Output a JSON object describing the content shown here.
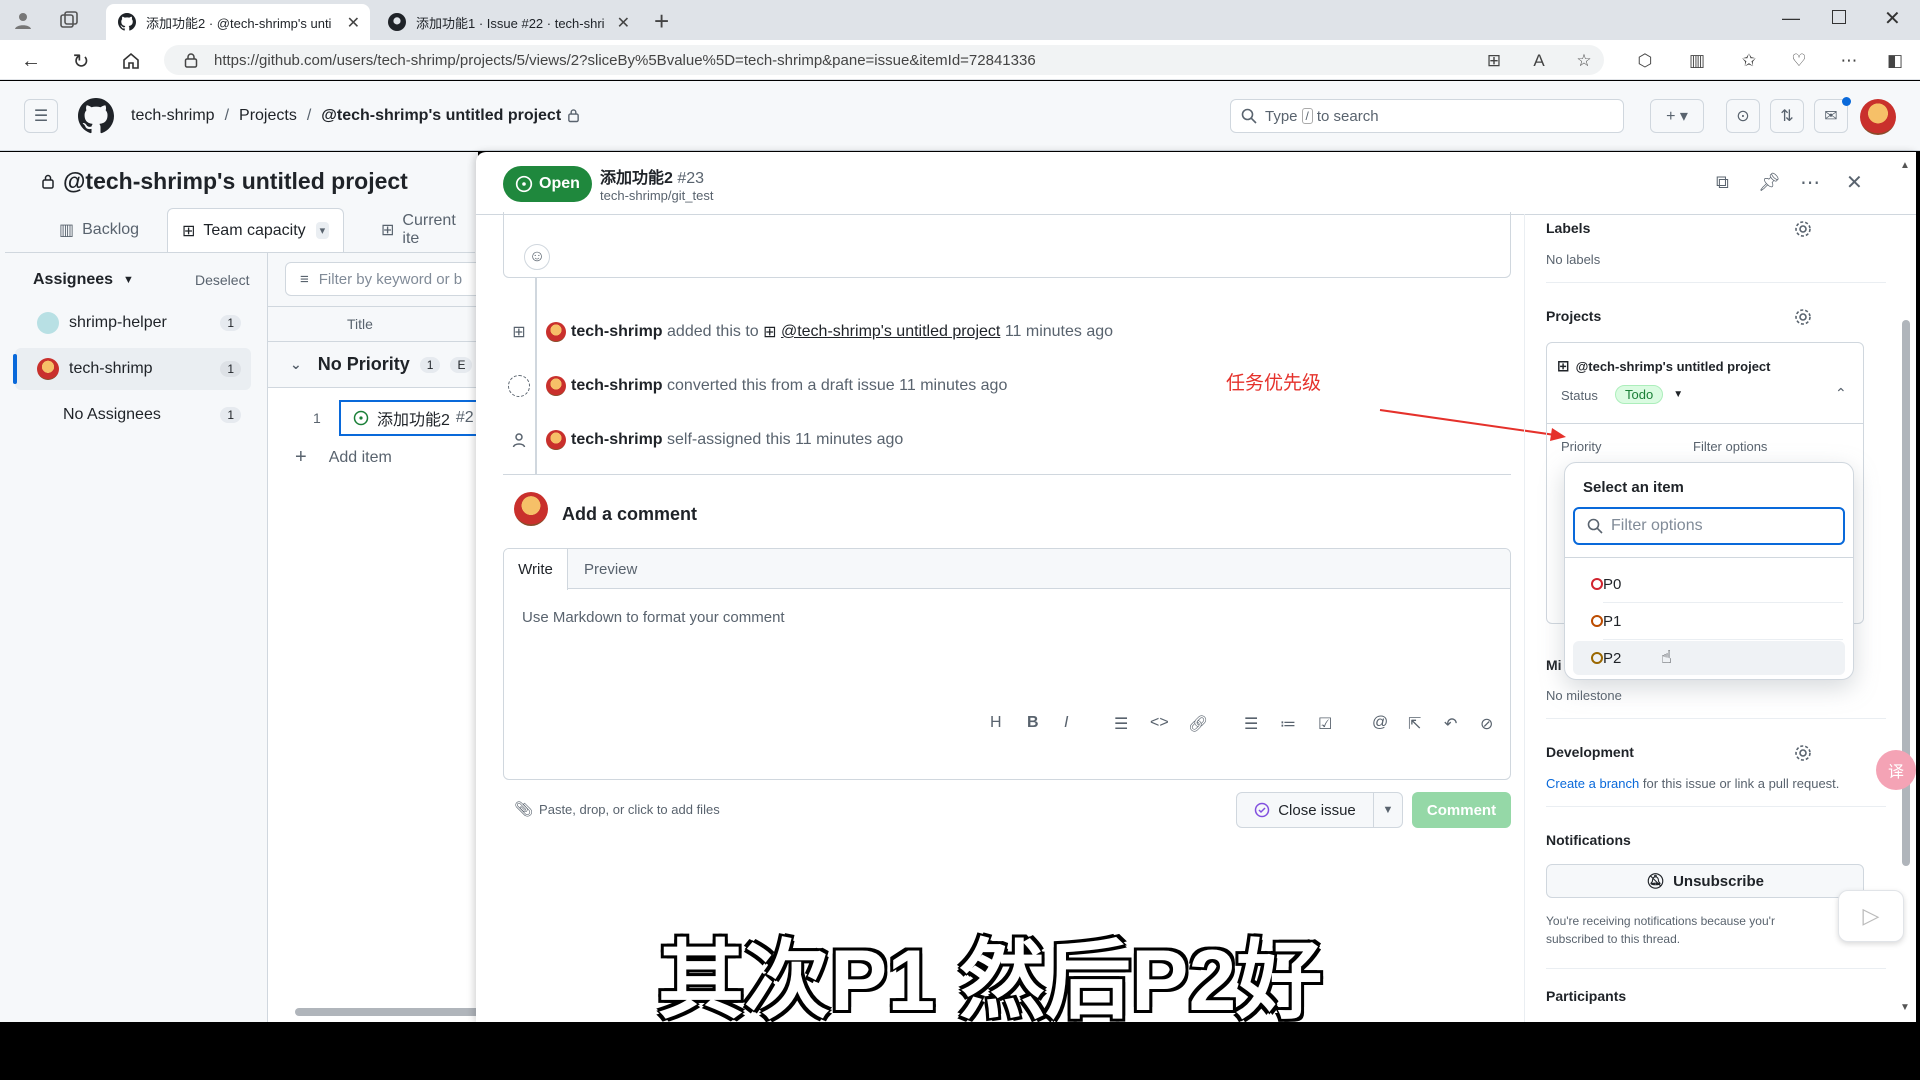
{
  "browser": {
    "tabs": [
      {
        "title": "添加功能2 · @tech-shrimp's unti"
      },
      {
        "title": "添加功能1 · Issue #22 · tech-shri"
      }
    ],
    "url": "https://github.com/users/tech-shrimp/projects/5/views/2?sliceBy%5Bvalue%5D=tech-shrimp&pane=issue&itemId=72841336"
  },
  "header": {
    "breadcrumb_user": "tech-shrimp",
    "breadcrumb_sep": "/",
    "breadcrumb_projects": "Projects",
    "breadcrumb_project": "@tech-shrimp's untitled project",
    "search_prefix": "Type",
    "search_key": "/",
    "search_suffix": "to search"
  },
  "project": {
    "title": "@tech-shrimp's untitled project",
    "tabs": [
      {
        "label": "Backlog"
      },
      {
        "label": "Team capacity"
      },
      {
        "label": "Current ite"
      }
    ],
    "slice_title": "Assignees",
    "deselect": "Deselect",
    "filter_placeholder": "Filter by keyword or b",
    "assignees": [
      {
        "name": "shrimp-helper",
        "count": "1"
      },
      {
        "name": "tech-shrimp",
        "count": "1"
      },
      {
        "name": "No Assignees",
        "count": "1"
      }
    ],
    "col_title": "Title",
    "group_label": "No Priority",
    "group_count": "1",
    "group_extra": "E",
    "row_num": "1",
    "row_title": "添加功能2",
    "row_num_suffix": "#2",
    "add_item": "Add item"
  },
  "issue": {
    "state": "Open",
    "title": "添加功能2",
    "number": "#23",
    "repo": "tech-shrimp/git_test",
    "timeline": [
      {
        "actor": "tech-shrimp",
        "text": "added this to",
        "link": "@tech-shrimp's untitled project",
        "time": "11 minutes ago"
      },
      {
        "actor": "tech-shrimp",
        "text": "converted this from a draft issue 11 minutes ago"
      },
      {
        "actor": "tech-shrimp",
        "text": "self-assigned this 11 minutes ago"
      }
    ],
    "add_comment": "Add a comment",
    "write_tab": "Write",
    "preview_tab": "Preview",
    "editor_placeholder": "Use Markdown to format your comment",
    "attach_hint": "Paste, drop, or click to add files",
    "close_issue": "Close issue",
    "comment_button": "Comment"
  },
  "sidebar": {
    "labels_title": "Labels",
    "labels_value": "No labels",
    "projects_title": "Projects",
    "project_name": "@tech-shrimp's untitled project",
    "status_label": "Status",
    "status_value": "Todo",
    "priority_label": "Priority",
    "priority_filter_hint": "Filter options",
    "milestone_title_partial": "Mi",
    "milestone_value": "No milestone",
    "development_title": "Development",
    "dev_link": "Create a branch",
    "dev_text": "for this issue or link a pull request.",
    "notifications_title": "Notifications",
    "unsubscribe": "Unsubscribe",
    "notif_text_1": "You're receiving notifications because you'r",
    "notif_text_2": "subscribed to this thread.",
    "participants_title": "Participants"
  },
  "dropdown": {
    "title": "Select an item",
    "filter_placeholder": "Filter options",
    "options": [
      {
        "label": "P0",
        "color": "#d1242f"
      },
      {
        "label": "P1",
        "color": "#bc4c00"
      },
      {
        "label": "P2",
        "color": "#9a6700"
      }
    ],
    "hovered": "P2"
  },
  "annotation": {
    "text": "任务优先级",
    "color": "#e5312b"
  },
  "video_subtitle": "其次P1 然后P2好"
}
